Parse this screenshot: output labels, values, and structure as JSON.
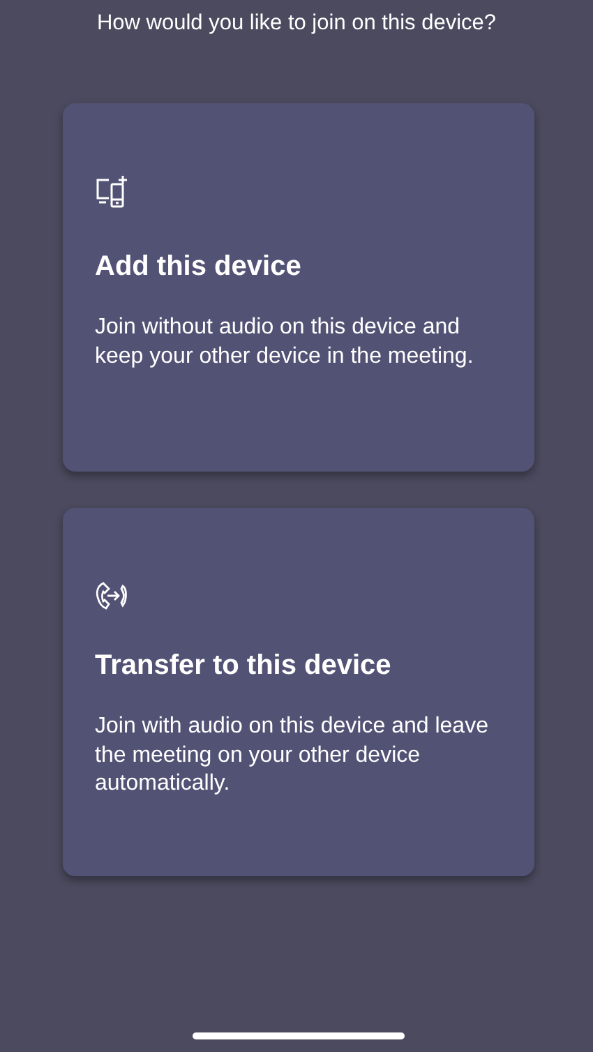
{
  "heading": "How would you like to join on this device?",
  "options": [
    {
      "kind": "add",
      "title": "Add this device",
      "description": "Join without audio on this device and keep your other device in the meeting."
    },
    {
      "kind": "transfer",
      "title": "Transfer to this device",
      "description": "Join with audio on this device and leave the meeting on your other device automatically."
    }
  ]
}
